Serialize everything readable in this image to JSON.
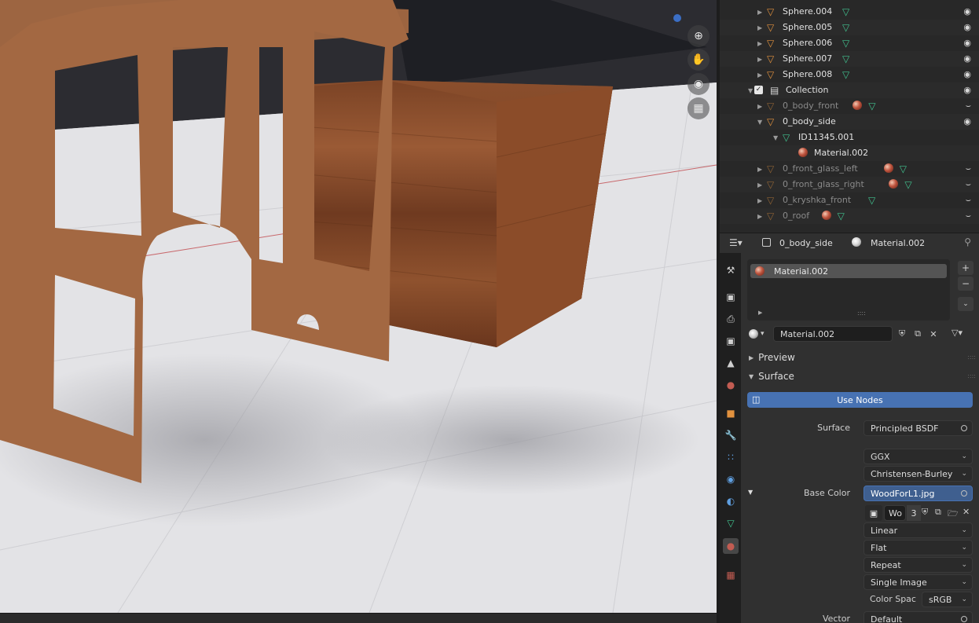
{
  "outliner": {
    "rows": [
      {
        "name": "Sphere.004",
        "indent": 1,
        "twisty": "right",
        "type": "mesh",
        "extras": [
          "mesh-data"
        ],
        "visible": true
      },
      {
        "name": "Sphere.005",
        "indent": 1,
        "twisty": "right",
        "type": "mesh",
        "extras": [
          "mesh-data"
        ],
        "visible": true
      },
      {
        "name": "Sphere.006",
        "indent": 1,
        "twisty": "right",
        "type": "mesh",
        "extras": [
          "mesh-data"
        ],
        "visible": true
      },
      {
        "name": "Sphere.007",
        "indent": 1,
        "twisty": "right",
        "type": "mesh",
        "extras": [
          "mesh-data"
        ],
        "visible": true
      },
      {
        "name": "Sphere.008",
        "indent": 1,
        "twisty": "right",
        "type": "mesh",
        "extras": [
          "mesh-data"
        ],
        "visible": true
      },
      {
        "name": "Collection",
        "indent": 0,
        "twisty": "down",
        "type": "collection",
        "extras": [],
        "visible": true,
        "checkbox": true
      },
      {
        "name": "0_body_front",
        "indent": 1,
        "twisty": "right",
        "type": "mesh",
        "extras": [
          "material",
          "mesh-data"
        ],
        "visible": false,
        "dim": true
      },
      {
        "name": "0_body_side",
        "indent": 1,
        "twisty": "down",
        "type": "mesh",
        "extras": [],
        "visible": true
      },
      {
        "name": "ID11345.001",
        "indent": 2,
        "twisty": "down",
        "type": "mesh-data",
        "extras": [],
        "visible": null
      },
      {
        "name": "Material.002",
        "indent": 3,
        "twisty": "",
        "type": "material",
        "extras": [],
        "visible": null
      },
      {
        "name": "0_front_glass_left",
        "indent": 1,
        "twisty": "right",
        "type": "mesh",
        "extras": [
          "material",
          "mesh-data"
        ],
        "visible": false,
        "dim": true
      },
      {
        "name": "0_front_glass_right",
        "indent": 1,
        "twisty": "right",
        "type": "mesh",
        "extras": [
          "material",
          "mesh-data"
        ],
        "visible": false,
        "dim": true
      },
      {
        "name": "0_kryshka_front",
        "indent": 1,
        "twisty": "right",
        "type": "mesh",
        "extras": [
          "mesh-data"
        ],
        "visible": false,
        "dim": true
      },
      {
        "name": "0_roof",
        "indent": 1,
        "twisty": "right",
        "type": "mesh",
        "extras": [
          "material",
          "mesh-data"
        ],
        "visible": false,
        "dim": true
      }
    ]
  },
  "header": {
    "object_name": "0_body_side",
    "material_name": "Material.002"
  },
  "slots": {
    "items": [
      "Material.002"
    ]
  },
  "material": {
    "name": "Material.002"
  },
  "sections": {
    "preview": "Preview",
    "surface": "Surface"
  },
  "surface": {
    "use_nodes": "Use Nodes",
    "surface_label": "Surface",
    "surface_value": "Principled BSDF",
    "distribution": "GGX",
    "subsurface": "Christensen-Burley",
    "base_color_label": "Base Color",
    "base_color_value": "WoodForL1.jpg",
    "image_name": "Wo",
    "image_users": "3",
    "interpolation": "Linear",
    "projection": "Flat",
    "extension": "Repeat",
    "source": "Single Image",
    "color_space_label": "Color Spac",
    "color_space_value": "sRGB",
    "vector_label": "Vector",
    "vector_value": "Default"
  },
  "colors": {
    "accent": "#4772b3",
    "mesh_icon": "#e1913e",
    "data_icon": "#41c28f",
    "material_icon": "#c25c52"
  }
}
